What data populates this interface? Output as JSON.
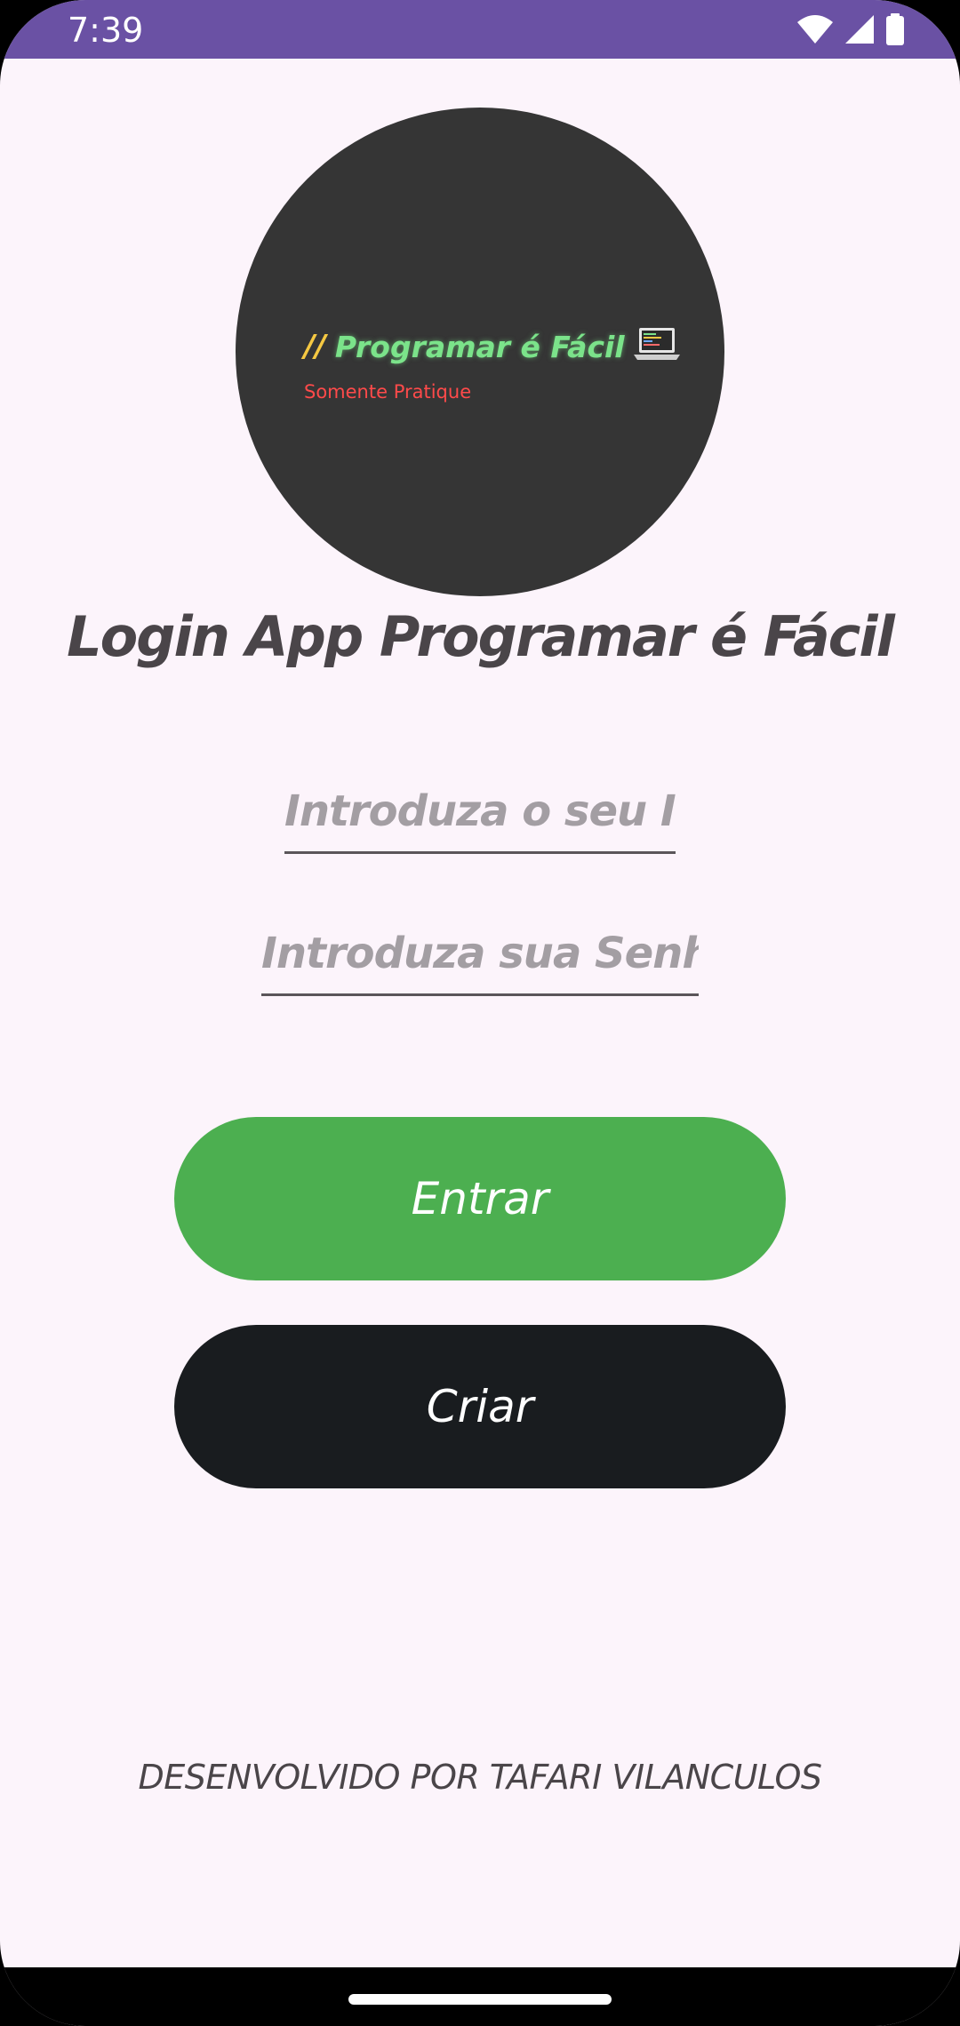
{
  "status_bar": {
    "time": "7:39",
    "icons": [
      "wifi-icon",
      "signal-icon",
      "battery-icon"
    ],
    "background_color": "#6A51A4"
  },
  "logo": {
    "slashes": "//",
    "title": "Programar é Fácil",
    "subtitle": "Somente Pratique",
    "icon": "laptop-icon"
  },
  "page": {
    "title": "Login App Programar é Fácil"
  },
  "form": {
    "id_value": "",
    "id_placeholder": "Introduza o seu ID",
    "password_value": "",
    "password_placeholder": "Introduza sua Senha"
  },
  "buttons": {
    "login_label": "Entrar",
    "login_color": "#4CAF50",
    "create_label": "Criar",
    "create_color": "#191C1F"
  },
  "footer": {
    "credits": "DESENVOLVIDO POR TAFARI VILANCULOS"
  },
  "colors": {
    "background": "#FCF4FB",
    "logo_background": "#353535",
    "logo_title": "#7BE38A",
    "logo_subtitle": "#FF4A4A"
  }
}
